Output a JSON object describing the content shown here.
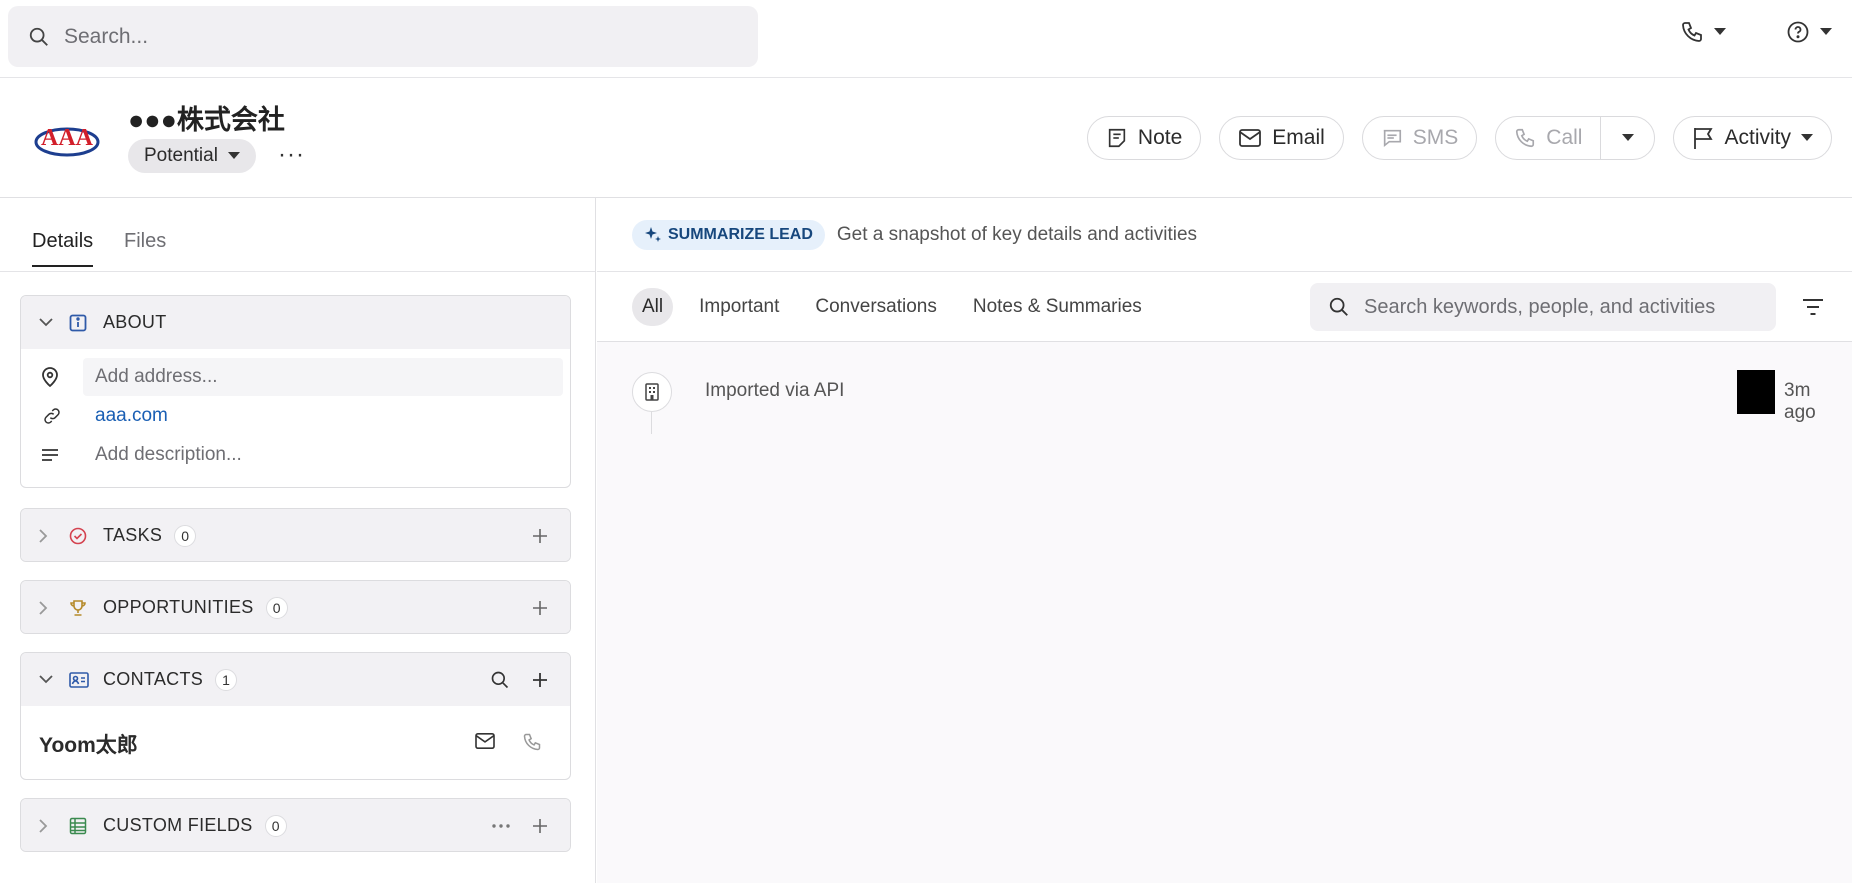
{
  "topbar": {
    "search_placeholder": "Search...",
    "phone_icon": "phone-icon",
    "help_icon": "help-icon"
  },
  "record": {
    "company_name": "●●●株式会社",
    "logo_text": "AAA",
    "status": "Potential",
    "more": "···"
  },
  "actions": {
    "note": "Note",
    "email": "Email",
    "sms": "SMS",
    "call": "Call",
    "activity": "Activity"
  },
  "left": {
    "tabs": [
      "Details",
      "Files"
    ],
    "about": {
      "title": "ABOUT",
      "address_placeholder": "Add address...",
      "website": "aaa.com",
      "description_placeholder": "Add description..."
    },
    "tasks": {
      "title": "TASKS",
      "count": "0"
    },
    "opportunities": {
      "title": "OPPORTUNITIES",
      "count": "0"
    },
    "contacts": {
      "title": "CONTACTS",
      "count": "1",
      "items": [
        {
          "name": "Yoom太郎"
        }
      ]
    },
    "custom_fields": {
      "title": "CUSTOM FIELDS",
      "count": "0"
    }
  },
  "right": {
    "summarize": {
      "badge": "SUMMARIZE LEAD",
      "text": "Get a snapshot of key details and activities"
    },
    "filters": [
      "All",
      "Important",
      "Conversations",
      "Notes & Summaries"
    ],
    "search_placeholder": "Search keywords, people, and activities",
    "feed": [
      {
        "text": "Imported via API",
        "time": "3m ago"
      }
    ]
  },
  "colors": {
    "accent_blue": "#1a5fb4",
    "badge_bg": "#e6f0fb",
    "panel_bg": "#f2f1f4"
  }
}
